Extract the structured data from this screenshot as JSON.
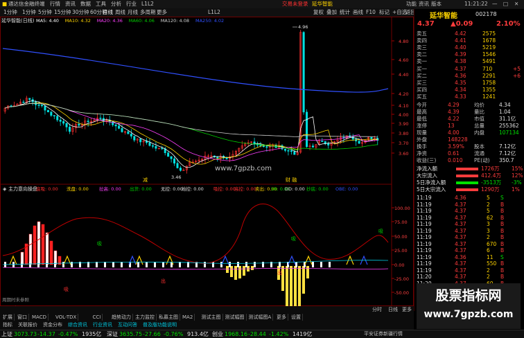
{
  "window": {
    "title": "通达信金融终端",
    "center_left": "交易未登录",
    "center_right": "延华智能",
    "right_btns": [
      "功能",
      "资讯",
      "版本"
    ],
    "clock": "11:21:22"
  },
  "menu": {
    "left": [
      "行情",
      "资讯",
      "数据",
      "工具",
      "分析",
      "行业",
      "L1L2"
    ],
    "periods": [
      "1分钟",
      "1分钟",
      "5分钟",
      "15分钟",
      "30分钟",
      "60分钟",
      "日线",
      "周线",
      "月线",
      "多周期",
      "更多"
    ],
    "right": [
      "复权",
      "叠加",
      "统计",
      "画线",
      "F10",
      "标记",
      "+自选",
      "返回"
    ]
  },
  "chart": {
    "stock_title": "延华智能(日线)",
    "ma_labels": [
      {
        "t": "MA5: 4.40",
        "c": "#ffffff"
      },
      {
        "t": "MA10: 4.32",
        "c": "#ffd400"
      },
      {
        "t": "MA20: 4.36",
        "c": "#ff40ff"
      },
      {
        "t": "MA60: 4.06",
        "c": "#00d000"
      },
      {
        "t": "MA120: 4.08",
        "c": "#d0d0d0"
      },
      {
        "t": "MA250: 4.02",
        "c": "#3050ff"
      }
    ],
    "price_ticks": [
      "4.80",
      "4.60",
      "4.40",
      "4.20",
      "4.10",
      "4.00",
      "3.90",
      "3.80",
      "3.70",
      "3.60"
    ],
    "high_label": "4.96",
    "low_label": "3.46",
    "site": "www.7gpzb.com",
    "marks": {
      "left": "减",
      "right": "财 融"
    },
    "indicator_title": "主力意向操盘",
    "indicator_labels": [
      {
        "t": "底吸: 0.00",
        "c": "#ff3030"
      },
      {
        "t": "洗盘: 0.00",
        "c": "#ffd400"
      },
      {
        "t": "拉高: 0.00",
        "c": "#ff40ff"
      },
      {
        "t": "出货: 0.00",
        "c": "#00d000"
      },
      {
        "t": "无控: 0.00",
        "c": "#e0e0e0"
      },
      {
        "t": "始控: 0.00",
        "c": "#e0e0e0"
      },
      {
        "t": "吸控: 0.00",
        "c": "#ff3030"
      },
      {
        "t": "高控: 0.00",
        "c": "#ff3030"
      },
      {
        "t": "卖出: 0.00",
        "c": "#ffd400"
      },
      {
        "t": "SR: 0.00",
        "c": "#00d000"
      },
      {
        "t": "DD: 0.00",
        "c": "#e0e0e0"
      },
      {
        "t": "抄底: 0.00",
        "c": "#00d000"
      },
      {
        "t": "OBE: 0.00",
        "c": "#3050ff"
      }
    ],
    "ind_ticks": [
      "100.00",
      "75.00",
      "50.00",
      "25.00",
      "0.00",
      "-25.00",
      "-50.00"
    ],
    "ind_marks": [
      "吸",
      "吸",
      "吸",
      "吸",
      "出",
      "出"
    ],
    "note": "周期时未参照",
    "date_axis": [
      "2023年",
      "5",
      "6",
      "7",
      "8",
      "9",
      "10"
    ]
  },
  "bottom": {
    "row1": [
      "分时",
      "日线",
      "更多"
    ],
    "row2": [
      "扩展",
      "窗口",
      "MACD",
      "VOL-TDX",
      "CCI",
      "趋势动力",
      "主力监控",
      "私募主图",
      "MA2",
      "测试主图",
      "测试幅图",
      "测试幅图A",
      "更多",
      "设置"
    ],
    "row3": [
      "指标",
      "关联报价",
      "资金分布",
      "综合资讯",
      "行业资讯",
      "互动问答",
      "普及版功能说明"
    ]
  },
  "panel": {
    "name": "延华智能",
    "code": "002178",
    "price": "4.37",
    "change": "0.09",
    "pct": "2.10%",
    "asks": [
      {
        "l": "卖五",
        "p": "4.42",
        "v": "2575"
      },
      {
        "l": "卖四",
        "p": "4.41",
        "v": "1678"
      },
      {
        "l": "卖三",
        "p": "4.40",
        "v": "5219"
      },
      {
        "l": "卖二",
        "p": "4.39",
        "v": "1546"
      },
      {
        "l": "卖一",
        "p": "4.38",
        "v": "5491"
      }
    ],
    "bids": [
      {
        "l": "买一",
        "p": "4.37",
        "v": "710",
        "d": "+5"
      },
      {
        "l": "买二",
        "p": "4.36",
        "v": "2291",
        "d": "+6"
      },
      {
        "l": "买三",
        "p": "4.35",
        "v": "1758",
        "d": ""
      },
      {
        "l": "买四",
        "p": "4.34",
        "v": "1355",
        "d": ""
      },
      {
        "l": "买五",
        "p": "4.33",
        "v": "1241",
        "d": ""
      }
    ],
    "stats": [
      {
        "a": "今开",
        "b": "4.29",
        "c": "均价",
        "d": "4.34"
      },
      {
        "a": "最高",
        "b": "4.39",
        "c": "量比",
        "d": "1.04"
      },
      {
        "a": "最低",
        "b": "4.22",
        "c": "市值",
        "d": "31.1亿"
      },
      {
        "a": "涨停",
        "b": "13",
        "c": "总量",
        "d": "255362"
      },
      {
        "a": "现量",
        "b": "4.00",
        "c": "内盘",
        "d": "107134"
      },
      {
        "a": "外盘",
        "b": "148228",
        "c": "",
        "d": ""
      },
      {
        "a": "换手",
        "b": "3.59%",
        "c": "股本",
        "d": "7.12亿"
      },
      {
        "a": "净资",
        "b": "0.61",
        "c": "流通",
        "d": "7.12亿"
      },
      {
        "a": "收益(三)",
        "b": "0.010",
        "c": "PE(动)",
        "d": "350.7"
      }
    ],
    "flows": [
      {
        "l": "净流入额",
        "v": "1726万",
        "p": "15%",
        "c": "#ff3c3c"
      },
      {
        "l": "大宗流入",
        "v": "412.4万",
        "p": "12%",
        "c": "#ff3c3c"
      },
      {
        "l": "5日净流入额",
        "v": "-3513万",
        "p": "-3%",
        "c": "#00e000"
      },
      {
        "l": "5日大宗流入",
        "v": "1290万",
        "p": "1%",
        "c": "#ff3c3c"
      }
    ],
    "ticks": [
      [
        "11:19",
        "4.36",
        "5",
        "S"
      ],
      [
        "11:19",
        "4.37",
        "2",
        "B"
      ],
      [
        "11:19",
        "4.37",
        "5",
        "B"
      ],
      [
        "11:19",
        "4.37",
        "62",
        "B"
      ],
      [
        "11:19",
        "4.37",
        "3",
        "B"
      ],
      [
        "11:19",
        "4.37",
        "3",
        "B"
      ],
      [
        "11:19",
        "4.37",
        "2",
        "B"
      ],
      [
        "11:19",
        "4.37",
        "670",
        "B"
      ],
      [
        "11:19",
        "4.37",
        "6",
        "B"
      ],
      [
        "11:19",
        "4.36",
        "11",
        "S"
      ],
      [
        "11:19",
        "4.37",
        "550",
        "B"
      ],
      [
        "11:19",
        "4.37",
        "2",
        "B"
      ],
      [
        "11:20",
        "4.37",
        "2",
        "B"
      ],
      [
        "11:20",
        "4.37",
        "60",
        "B"
      ],
      [
        "11:20",
        "4.37",
        "2",
        "B"
      ],
      [
        "11:20",
        "4.37",
        "5",
        "B"
      ],
      [
        "11:20",
        "4.37",
        "2",
        "B"
      ],
      [
        "11:20",
        "4.37",
        "1",
        "B"
      ],
      [
        "11:20",
        "4.37",
        "5",
        "B"
      ],
      [
        "11:20",
        "4.37",
        "2",
        "B"
      ],
      [
        "11:21",
        "4.36",
        "1",
        "S"
      ],
      [
        "11:21",
        "4.37",
        "2",
        "B"
      ],
      [
        "11:21",
        "4.37",
        "5",
        "B"
      ]
    ]
  },
  "status": {
    "items": [
      {
        "n": "上证",
        "v": "3073.73",
        "c": "-14.37",
        "p": "-0.47%",
        "a": "1935亿"
      },
      {
        "n": "深证",
        "v": "3635.75",
        "c": "-27.66",
        "p": "-0.76%",
        "a": "913.4亿"
      },
      {
        "n": "创业",
        "v": "1968.16",
        "c": "-28.44",
        "p": "-1.42%",
        "a": "1419亿"
      }
    ],
    "right": "平安证券新疆行情"
  },
  "watermark": {
    "title": "股票指标网",
    "url": "www.7gpzb.com"
  }
}
